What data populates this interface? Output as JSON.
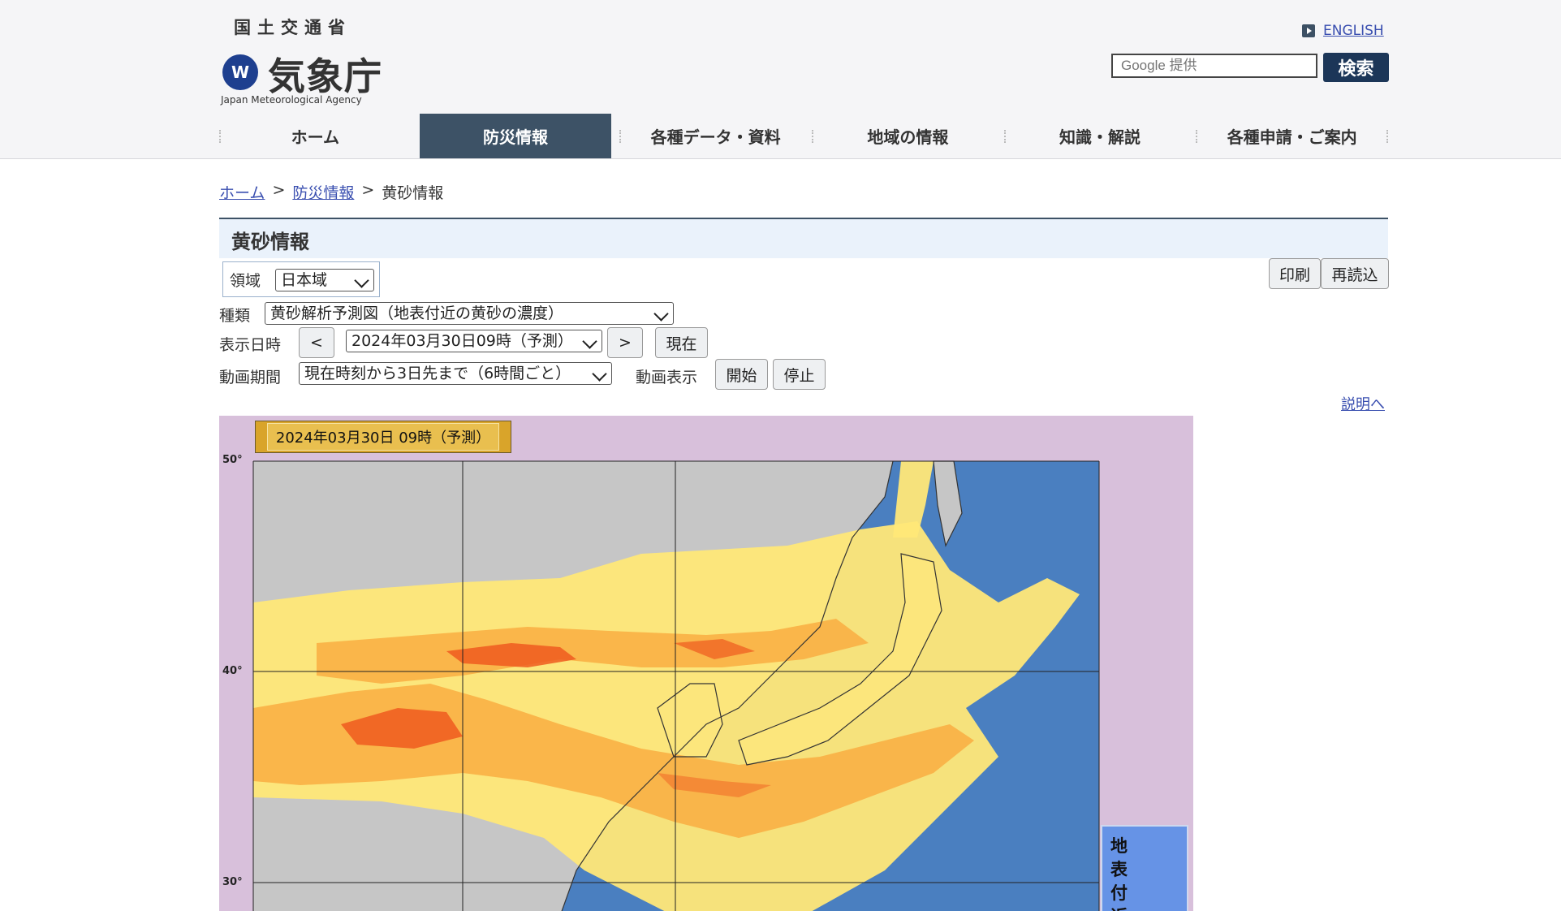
{
  "header": {
    "ministry": "国土交通省",
    "agency": "気象庁",
    "agency_en": "Japan Meteorological Agency",
    "english_link": "ENGLISH",
    "search_placeholder": "Google 提供",
    "search_button": "検索"
  },
  "nav": {
    "items": [
      "ホーム",
      "防災情報",
      "各種データ・資料",
      "地域の情報",
      "知識・解説",
      "各種申請・ご案内"
    ],
    "active": "防災情報"
  },
  "breadcrumb": {
    "home": "ホーム",
    "sep": ">",
    "disaster": "防災情報",
    "current": "黄砂情報"
  },
  "page_title": "黄砂情報",
  "controls": {
    "region_label": "領域",
    "region_value": "日本域",
    "print_button": "印刷",
    "reload_button": "再読込",
    "type_label": "種類",
    "type_value": "黄砂解析予測図（地表付近の黄砂の濃度）",
    "datetime_label": "表示日時",
    "prev_button": "<",
    "datetime_value": "2024年03月30日09時（予測）",
    "next_button": ">",
    "now_button": "現在",
    "animation_period_label": "動画期間",
    "animation_period_value": "現在時刻から3日先まで（6時間ごと）",
    "animation_display_label": "動画表示",
    "start_button": "開始",
    "stop_button": "停止",
    "explain_link": "説明へ"
  },
  "map": {
    "timestamp": "2024年03月30日  09時（予測）",
    "lat_labels": [
      "50°",
      "40°",
      "30°"
    ],
    "legend_text": "地表付近",
    "colors": {
      "frame": "#d8c0db",
      "sea": "#4a7fc0",
      "land": "#c8c8c8",
      "light": "#ffe878",
      "mid": "#f9b045",
      "high": "#ee5a1e"
    }
  }
}
